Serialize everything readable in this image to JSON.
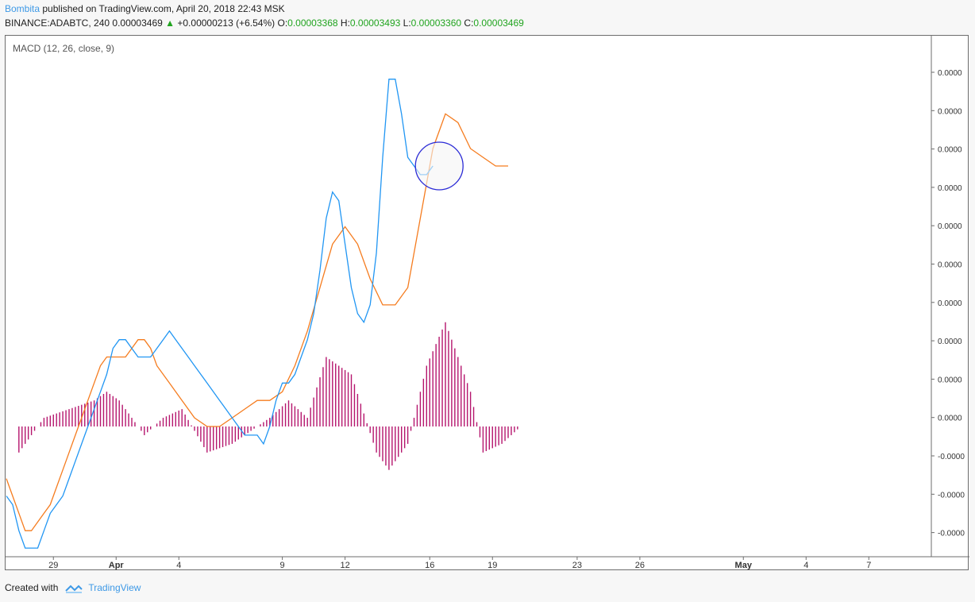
{
  "header": {
    "author": "Bombita",
    "published_text": "published on TradingView.com, April 20, 2018 22:43 MSK",
    "symbol": "BINANCE:ADABTC, 240",
    "last": "0.00003469",
    "up_arrow": "▲",
    "change": "+0.00000213 (+6.54%)",
    "open_label": "O:",
    "open": "0.00003368",
    "high_label": "H:",
    "high": "0.00003493",
    "low_label": "L:",
    "low": "0.00003360",
    "close_label": "C:",
    "close": "0.00003469"
  },
  "footer": {
    "created_with": "Created with",
    "brand": "TradingView"
  },
  "colors": {
    "macd": "#2196f3",
    "signal": "#f57c1f",
    "histogram": "#b5156d",
    "circle": "#2b2bd6"
  },
  "chart_data": {
    "type": "line",
    "indicator_label": "MACD (12, 26, close, 9)",
    "y_tick_labels": [
      "0.0000",
      "0.0000",
      "0.0000",
      "0.0000",
      "0.0000",
      "0.0000",
      "0.0000",
      "0.0000",
      "0.0000",
      "0.0000",
      "-0.0000",
      "-0.0000",
      "-0.0000"
    ],
    "x_tick_labels": [
      "29",
      "Apr",
      "4",
      "9",
      "12",
      "16",
      "19",
      "23",
      "26",
      "May",
      "4",
      "7"
    ],
    "x_index_at_tick": [
      15,
      35,
      55,
      88,
      108,
      135,
      155,
      182,
      202,
      235,
      255,
      275
    ],
    "ylim": [
      -1.5e-06,
      4.5e-06
    ],
    "series": [
      {
        "name": "MACD",
        "values": [
          -8e-07,
          -9e-07,
          -1.2e-06,
          -1.4e-06,
          -1.4e-06,
          -1.4e-06,
          -1.2e-06,
          -1e-06,
          -9e-07,
          -8e-07,
          -6e-07,
          -4e-07,
          -2e-07,
          0.0,
          2e-07,
          4e-07,
          6e-07,
          9e-07,
          1e-06,
          1e-06,
          9e-07,
          8e-07,
          8e-07,
          8e-07,
          9e-07,
          1e-06,
          1.1e-06,
          1e-06,
          9e-07,
          8e-07,
          7e-07,
          6e-07,
          5e-07,
          4e-07,
          3e-07,
          2e-07,
          1e-07,
          0.0,
          -1e-07,
          -1e-07,
          -1e-07,
          -2e-07,
          0.0,
          3e-07,
          5e-07,
          5e-07,
          6e-07,
          8e-07,
          1e-06,
          1.3e-06,
          1.8e-06,
          2.4e-06,
          2.7e-06,
          2.6e-06,
          2.1e-06,
          1.6e-06,
          1.3e-06,
          1.2e-06,
          1.4e-06,
          2e-06,
          3.1e-06,
          4e-06,
          4e-06,
          3.6e-06,
          3.1e-06,
          3e-06,
          2.9e-06,
          2.9e-06,
          3e-06
        ],
        "indices": [
          0,
          2,
          4,
          6,
          8,
          10,
          12,
          14,
          16,
          18,
          20,
          22,
          24,
          26,
          28,
          30,
          32,
          34,
          36,
          38,
          40,
          42,
          44,
          46,
          48,
          50,
          52,
          54,
          56,
          58,
          60,
          62,
          64,
          66,
          68,
          70,
          72,
          74,
          76,
          78,
          80,
          82,
          84,
          86,
          88,
          90,
          92,
          94,
          96,
          98,
          100,
          102,
          104,
          106,
          108,
          110,
          112,
          114,
          116,
          118,
          120,
          122,
          124,
          126,
          128,
          130,
          132,
          134,
          136
        ]
      },
      {
        "name": "Signal",
        "values": [
          -6e-07,
          -8e-07,
          -1e-06,
          -1.2e-06,
          -1.2e-06,
          -1.1e-06,
          -1e-06,
          -9e-07,
          -7e-07,
          -5e-07,
          -3e-07,
          -1e-07,
          1e-07,
          3e-07,
          5e-07,
          7e-07,
          8e-07,
          8e-07,
          8e-07,
          8e-07,
          9e-07,
          1e-06,
          1e-06,
          9e-07,
          7e-07,
          5e-07,
          3e-07,
          1e-07,
          0.0,
          0.0,
          1e-07,
          2e-07,
          3e-07,
          3e-07,
          4e-07,
          7e-07,
          1.1e-06,
          1.6e-06,
          2.1e-06,
          2.3e-06,
          2.1e-06,
          1.7e-06,
          1.4e-06,
          1.4e-06,
          1.6e-06,
          2.4e-06,
          3.2e-06,
          3.6e-06,
          3.5e-06,
          3.2e-06,
          3.1e-06,
          3e-06,
          3e-06
        ],
        "indices": [
          0,
          2,
          4,
          6,
          8,
          10,
          12,
          14,
          16,
          18,
          20,
          22,
          24,
          26,
          28,
          30,
          32,
          34,
          36,
          38,
          40,
          42,
          44,
          46,
          48,
          52,
          56,
          60,
          64,
          68,
          72,
          76,
          80,
          84,
          88,
          92,
          96,
          100,
          104,
          108,
          112,
          116,
          120,
          124,
          128,
          132,
          136,
          140,
          144,
          148,
          152,
          156,
          160
        ]
      },
      {
        "name": "Histogram",
        "values": [
          -3e-07,
          1e-07,
          2e-07,
          3e-07,
          4e-07,
          3e-07,
          1e-07,
          -1e-07,
          1e-07,
          2e-07,
          -3e-07,
          -2e-07,
          1e-07,
          3e-07,
          1e-07,
          8e-07,
          6e-07,
          -3e-07,
          -5e-07,
          -2e-07,
          7e-07,
          1.2e-06,
          4e-07,
          -3e-07,
          -2e-07,
          0.0
        ],
        "indices": [
          4,
          12,
          20,
          28,
          32,
          36,
          40,
          44,
          50,
          56,
          64,
          72,
          84,
          90,
          96,
          102,
          110,
          118,
          122,
          128,
          134,
          140,
          148,
          152,
          158,
          164
        ]
      }
    ]
  }
}
